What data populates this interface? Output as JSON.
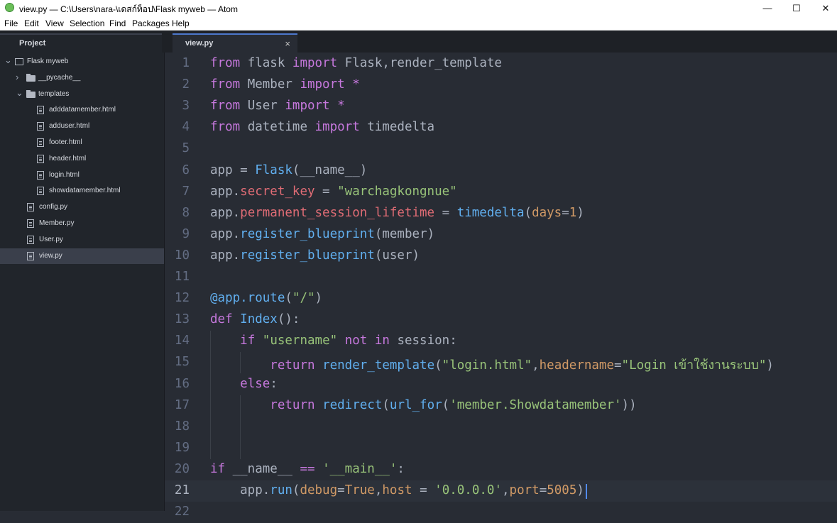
{
  "window": {
    "title": "view.py — C:\\Users\\nara-\\เดสก์ท็อป\\Flask myweb — Atom",
    "minimize": "—",
    "maximize": "☐",
    "close": "✕"
  },
  "menu": [
    "File",
    "Edit",
    "View",
    "Selection",
    "Find",
    "Packages",
    "Help"
  ],
  "tabs": {
    "project_label": "Project",
    "file_label": "view.py",
    "close_glyph": "×"
  },
  "tree": [
    {
      "name": "Flask myweb",
      "type": "repo",
      "expanded": true
    },
    {
      "name": "__pycache__",
      "type": "folder",
      "expanded": false
    },
    {
      "name": "templates",
      "type": "folder",
      "expanded": true
    },
    {
      "name": "adddatamember.html",
      "type": "file"
    },
    {
      "name": "adduser.html",
      "type": "file"
    },
    {
      "name": "footer.html",
      "type": "file"
    },
    {
      "name": "header.html",
      "type": "file"
    },
    {
      "name": "login.html",
      "type": "file"
    },
    {
      "name": "showdatamember.html",
      "type": "file"
    },
    {
      "name": "config.py",
      "type": "file"
    },
    {
      "name": "Member.py",
      "type": "file"
    },
    {
      "name": "User.py",
      "type": "file"
    },
    {
      "name": "view.py",
      "type": "file",
      "selected": true
    }
  ],
  "code": {
    "line_numbers": [
      "1",
      "2",
      "3",
      "4",
      "5",
      "6",
      "7",
      "8",
      "9",
      "10",
      "11",
      "12",
      "13",
      "14",
      "15",
      "16",
      "17",
      "18",
      "19",
      "20",
      "21",
      "22"
    ],
    "cursor_line": 21,
    "lines": [
      [
        [
          "kw",
          "from"
        ],
        [
          "plain",
          " flask "
        ],
        [
          "kw",
          "import"
        ],
        [
          "plain",
          " Flask,render_template"
        ]
      ],
      [
        [
          "kw",
          "from"
        ],
        [
          "plain",
          " Member "
        ],
        [
          "kw",
          "import"
        ],
        [
          "plain",
          " "
        ],
        [
          "kw",
          "*"
        ]
      ],
      [
        [
          "kw",
          "from"
        ],
        [
          "plain",
          " User "
        ],
        [
          "kw",
          "import"
        ],
        [
          "plain",
          " "
        ],
        [
          "kw",
          "*"
        ]
      ],
      [
        [
          "kw",
          "from"
        ],
        [
          "plain",
          " datetime "
        ],
        [
          "kw",
          "import"
        ],
        [
          "plain",
          " timedelta"
        ]
      ],
      [],
      [
        [
          "plain",
          "app "
        ],
        [
          "plain",
          "= "
        ],
        [
          "fn",
          "Flask"
        ],
        [
          "plain",
          "(__name__)"
        ]
      ],
      [
        [
          "plain",
          "app."
        ],
        [
          "prop",
          "secret_key"
        ],
        [
          "plain",
          " = "
        ],
        [
          "str",
          "\"warchagkongnue\""
        ]
      ],
      [
        [
          "plain",
          "app."
        ],
        [
          "prop",
          "permanent_session_lifetime"
        ],
        [
          "plain",
          " = "
        ],
        [
          "fn",
          "timedelta"
        ],
        [
          "plain",
          "("
        ],
        [
          "attr",
          "days"
        ],
        [
          "plain",
          "="
        ],
        [
          "num",
          "1"
        ],
        [
          "plain",
          ")"
        ]
      ],
      [
        [
          "plain",
          "app."
        ],
        [
          "fn",
          "register_blueprint"
        ],
        [
          "plain",
          "(member)"
        ]
      ],
      [
        [
          "plain",
          "app."
        ],
        [
          "fn",
          "register_blueprint"
        ],
        [
          "plain",
          "(user)"
        ]
      ],
      [],
      [
        [
          "fn",
          "@app.route"
        ],
        [
          "plain",
          "("
        ],
        [
          "str",
          "\"/\""
        ],
        [
          "plain",
          ")"
        ]
      ],
      [
        [
          "kw",
          "def"
        ],
        [
          "plain",
          " "
        ],
        [
          "fn",
          "Index"
        ],
        [
          "plain",
          "():"
        ]
      ],
      [
        [
          "plain",
          "    "
        ],
        [
          "kw",
          "if"
        ],
        [
          "plain",
          " "
        ],
        [
          "str",
          "\"username\""
        ],
        [
          "plain",
          " "
        ],
        [
          "kw",
          "not in"
        ],
        [
          "plain",
          " session:"
        ]
      ],
      [
        [
          "plain",
          "        "
        ],
        [
          "kw",
          "return"
        ],
        [
          "plain",
          " "
        ],
        [
          "fn",
          "render_template"
        ],
        [
          "plain",
          "("
        ],
        [
          "str",
          "\"login.html\""
        ],
        [
          "plain",
          ","
        ],
        [
          "attr",
          "headername"
        ],
        [
          "plain",
          "="
        ],
        [
          "str",
          "\"Login เข้าใช้งานระบบ\""
        ],
        [
          "plain",
          ")"
        ]
      ],
      [
        [
          "plain",
          "    "
        ],
        [
          "kw",
          "else"
        ],
        [
          "plain",
          ":"
        ]
      ],
      [
        [
          "plain",
          "        "
        ],
        [
          "kw",
          "return"
        ],
        [
          "plain",
          " "
        ],
        [
          "fn",
          "redirect"
        ],
        [
          "plain",
          "("
        ],
        [
          "fn",
          "url_for"
        ],
        [
          "plain",
          "("
        ],
        [
          "str",
          "'member.Showdatamember'"
        ],
        [
          "plain",
          "))"
        ]
      ],
      [],
      [],
      [
        [
          "kw",
          "if"
        ],
        [
          "plain",
          " __name__ "
        ],
        [
          "kw",
          "=="
        ],
        [
          "plain",
          " "
        ],
        [
          "str",
          "'__main__'"
        ],
        [
          "plain",
          ":"
        ]
      ],
      [
        [
          "plain",
          "    app."
        ],
        [
          "fn",
          "run"
        ],
        [
          "plain",
          "("
        ],
        [
          "attr",
          "debug"
        ],
        [
          "plain",
          "="
        ],
        [
          "num",
          "True"
        ],
        [
          "plain",
          ","
        ],
        [
          "attr",
          "host"
        ],
        [
          "plain",
          " = "
        ],
        [
          "str",
          "'0.0.0.0'"
        ],
        [
          "plain",
          ","
        ],
        [
          "attr",
          "port"
        ],
        [
          "plain",
          "="
        ],
        [
          "num",
          "5005"
        ],
        [
          "plain",
          ")"
        ]
      ],
      []
    ]
  }
}
